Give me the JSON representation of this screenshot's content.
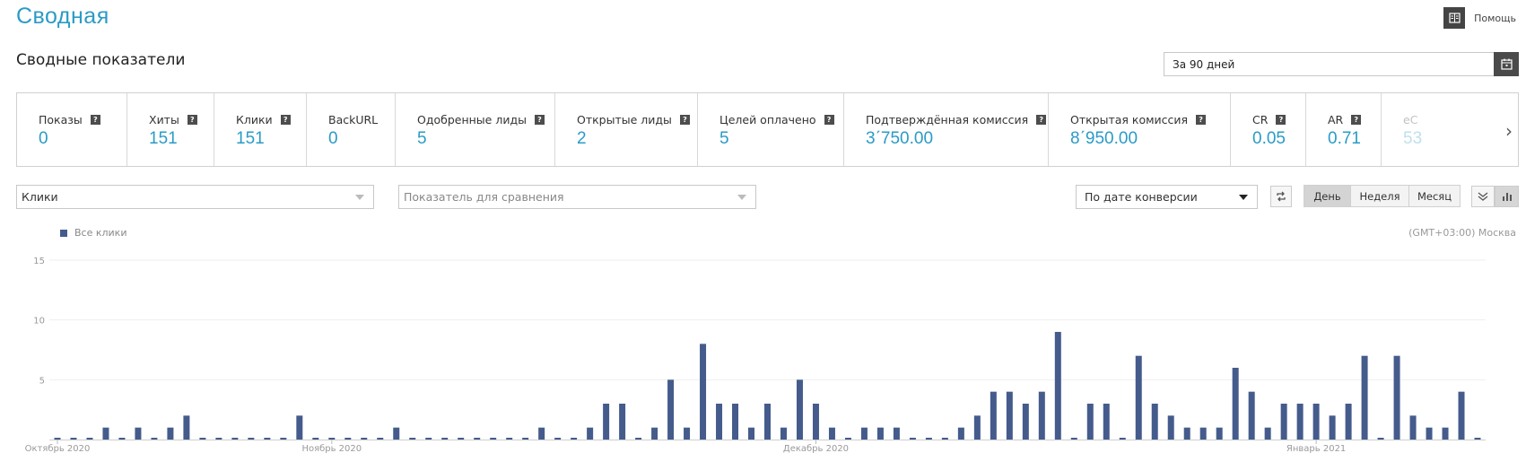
{
  "header": {
    "title": "Сводная",
    "help_label": "Помощь"
  },
  "summary": {
    "title": "Сводные показатели",
    "period_value": "За 90 дней"
  },
  "stats": [
    {
      "label": "Показы",
      "value": "0",
      "has_help": true
    },
    {
      "label": "Хиты",
      "value": "151",
      "has_help": true
    },
    {
      "label": "Клики",
      "value": "151",
      "has_help": true
    },
    {
      "label": "BackURL",
      "value": "0",
      "has_help": false
    },
    {
      "label": "Одобренные лиды",
      "value": "5",
      "has_help": true
    },
    {
      "label": "Открытые лиды",
      "value": "2",
      "has_help": true
    },
    {
      "label": "Целей оплачено",
      "value": "5",
      "has_help": true
    },
    {
      "label": "Подтверждённая комиссия",
      "value": "3ˊ750.00",
      "has_help": true
    },
    {
      "label": "Открытая комиссия",
      "value": "8ˊ950.00",
      "has_help": true
    },
    {
      "label": "CR",
      "value": "0.05",
      "has_help": true
    },
    {
      "label": "AR",
      "value": "0.71",
      "has_help": true
    },
    {
      "label": "eC",
      "value": "53",
      "has_help": false
    }
  ],
  "controls": {
    "metric_select": "Клики",
    "compare_placeholder": "Показатель для сравнения",
    "date_mode_select": "По дате конверсии",
    "granularity": [
      {
        "label": "День",
        "active": true
      },
      {
        "label": "Неделя",
        "active": false
      },
      {
        "label": "Месяц",
        "active": false
      }
    ]
  },
  "chart_legend": "Все клики",
  "timezone": "(GMT+03:00) Москва",
  "colors": {
    "accent": "#2a9bc6",
    "bar": "#445b8c"
  },
  "chart_data": {
    "type": "bar",
    "ylim": [
      0,
      15
    ],
    "yticks": [
      15,
      10,
      5
    ],
    "x_tick_labels": [
      {
        "label": "Октябрь 2020",
        "index": 0
      },
      {
        "label": "Ноябрь 2020",
        "index": 17
      },
      {
        "label": "Декабрь 2020",
        "index": 47
      },
      {
        "label": "Январь 2021",
        "index": 78
      }
    ],
    "series": [
      {
        "name": "Все клики",
        "values": [
          0,
          0,
          0,
          1,
          0,
          1,
          0,
          1,
          2,
          0,
          0,
          0,
          0,
          0,
          0,
          2,
          0,
          0,
          0,
          0,
          0,
          1,
          0,
          0,
          0,
          0,
          0,
          0,
          0,
          0,
          1,
          0,
          0,
          1,
          3,
          3,
          0,
          1,
          5,
          1,
          8,
          3,
          3,
          1,
          3,
          1,
          5,
          3,
          1,
          0,
          1,
          1,
          1,
          0,
          0,
          0,
          1,
          2,
          4,
          4,
          3,
          4,
          9,
          0,
          3,
          3,
          0,
          7,
          3,
          2,
          1,
          1,
          1,
          6,
          4,
          1,
          3,
          3,
          3,
          2,
          3,
          7,
          0,
          7,
          2,
          1,
          1,
          4,
          0
        ]
      }
    ]
  }
}
